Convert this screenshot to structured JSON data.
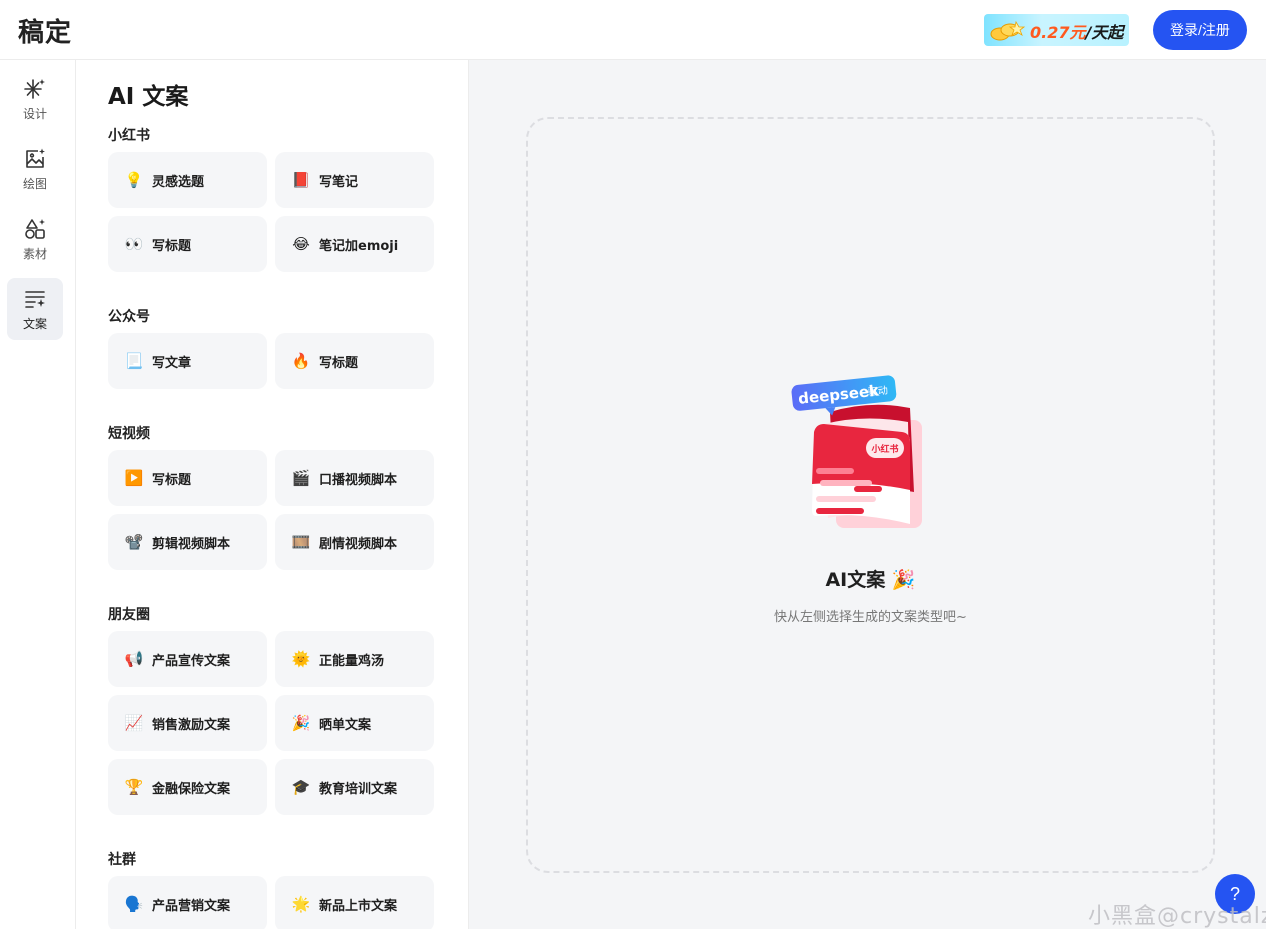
{
  "header": {
    "logo": "稿定",
    "promo_price": "0.27元",
    "promo_unit": "/天起",
    "login_label": "登录/注册"
  },
  "rail": {
    "items": [
      {
        "label": "设计",
        "icon": "sparkle-icon"
      },
      {
        "label": "绘图",
        "icon": "image-sparkle-icon"
      },
      {
        "label": "素材",
        "icon": "shapes-icon"
      },
      {
        "label": "文案",
        "icon": "text-sparkle-icon",
        "active": true
      }
    ]
  },
  "panel": {
    "title": "AI 文案",
    "sections": [
      {
        "title": "小红书",
        "items": [
          {
            "icon": "💡",
            "label": "灵感选题"
          },
          {
            "icon": "📕",
            "label": "写笔记"
          },
          {
            "icon": "👀",
            "label": "写标题"
          },
          {
            "icon": "😂",
            "label": "笔记加emoji"
          }
        ]
      },
      {
        "title": "公众号",
        "items": [
          {
            "icon": "📃",
            "label": "写文章"
          },
          {
            "icon": "🔥",
            "label": "写标题"
          }
        ]
      },
      {
        "title": "短视频",
        "items": [
          {
            "icon": "▶️",
            "label": "写标题"
          },
          {
            "icon": "🎬",
            "label": "口播视频脚本"
          },
          {
            "icon": "📽️",
            "label": "剪辑视频脚本"
          },
          {
            "icon": "🎞️",
            "label": "剧情视频脚本"
          }
        ]
      },
      {
        "title": "朋友圈",
        "items": [
          {
            "icon": "📢",
            "label": "产品宣传文案"
          },
          {
            "icon": "🌞",
            "label": "正能量鸡汤"
          },
          {
            "icon": "📈",
            "label": "销售激励文案"
          },
          {
            "icon": "🎉",
            "label": "晒单文案"
          },
          {
            "icon": "🏆",
            "label": "金融保险文案"
          },
          {
            "icon": "🎓",
            "label": "教育培训文案"
          }
        ]
      },
      {
        "title": "社群",
        "items": [
          {
            "icon": "🗣️",
            "label": "产品营销文案"
          },
          {
            "icon": "🌟",
            "label": "新品上市文案"
          }
        ]
      }
    ]
  },
  "main": {
    "badge_text": "deepseek",
    "badge_suffix": "驱动",
    "card_tag": "小红书",
    "empty_title": "AI文案 🎉",
    "empty_subtitle": "快从左侧选择生成的文案类型吧~"
  },
  "help_label": "?",
  "watermark": "小黑盒@crystalz",
  "colors": {
    "accent": "#2554f2",
    "card_bg": "#f5f6f8",
    "main_bg": "#f4f5f7",
    "red": "#e8263f"
  }
}
